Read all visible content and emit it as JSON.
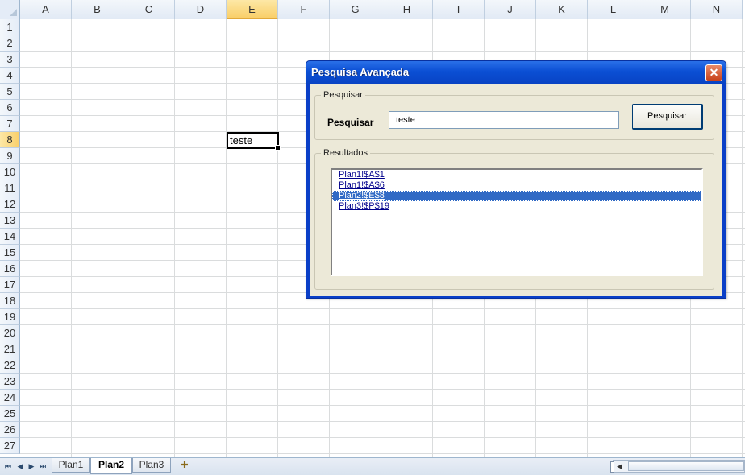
{
  "spreadsheet": {
    "columns": [
      "A",
      "B",
      "C",
      "D",
      "E",
      "F",
      "G",
      "H",
      "I",
      "J",
      "K",
      "L",
      "M",
      "N"
    ],
    "rows": [
      "1",
      "2",
      "3",
      "4",
      "5",
      "6",
      "7",
      "8",
      "9",
      "10",
      "11",
      "12",
      "13",
      "14",
      "15",
      "16",
      "17",
      "18",
      "19",
      "20",
      "21",
      "22",
      "23",
      "24",
      "25",
      "26",
      "27"
    ],
    "active_column": "E",
    "active_row": "8",
    "active_cell_value": "teste"
  },
  "sheet_tabs": [
    {
      "label": "Plan1",
      "active": false
    },
    {
      "label": "Plan2",
      "active": true
    },
    {
      "label": "Plan3",
      "active": false
    }
  ],
  "dialog": {
    "title": "Pesquisa Avançada",
    "close_glyph": "✕",
    "search_group_label": "Pesquisar",
    "search_label": "Pesquisar",
    "search_value": "teste",
    "search_button": "Pesquisar",
    "results_group_label": "Resultados",
    "results": [
      {
        "text": "Plan1!$A$1",
        "selected": false
      },
      {
        "text": "Plan1!$A$6",
        "selected": false
      },
      {
        "text": "Plan2!$E$8",
        "selected": true
      },
      {
        "text": "Plan3!$P$19",
        "selected": false
      }
    ]
  },
  "colors": {
    "dialog_title_blue": "#0b4fd4",
    "selection_blue": "#316ac5",
    "active_header": "#f9cf6a",
    "dialog_body": "#ece9d8"
  },
  "icons": {
    "nav_first": "first-sheet-icon",
    "nav_prev": "prev-sheet-icon",
    "nav_next": "next-sheet-icon",
    "nav_last": "last-sheet-icon",
    "insert_sheet": "insert-sheet-icon",
    "close": "close-icon"
  }
}
